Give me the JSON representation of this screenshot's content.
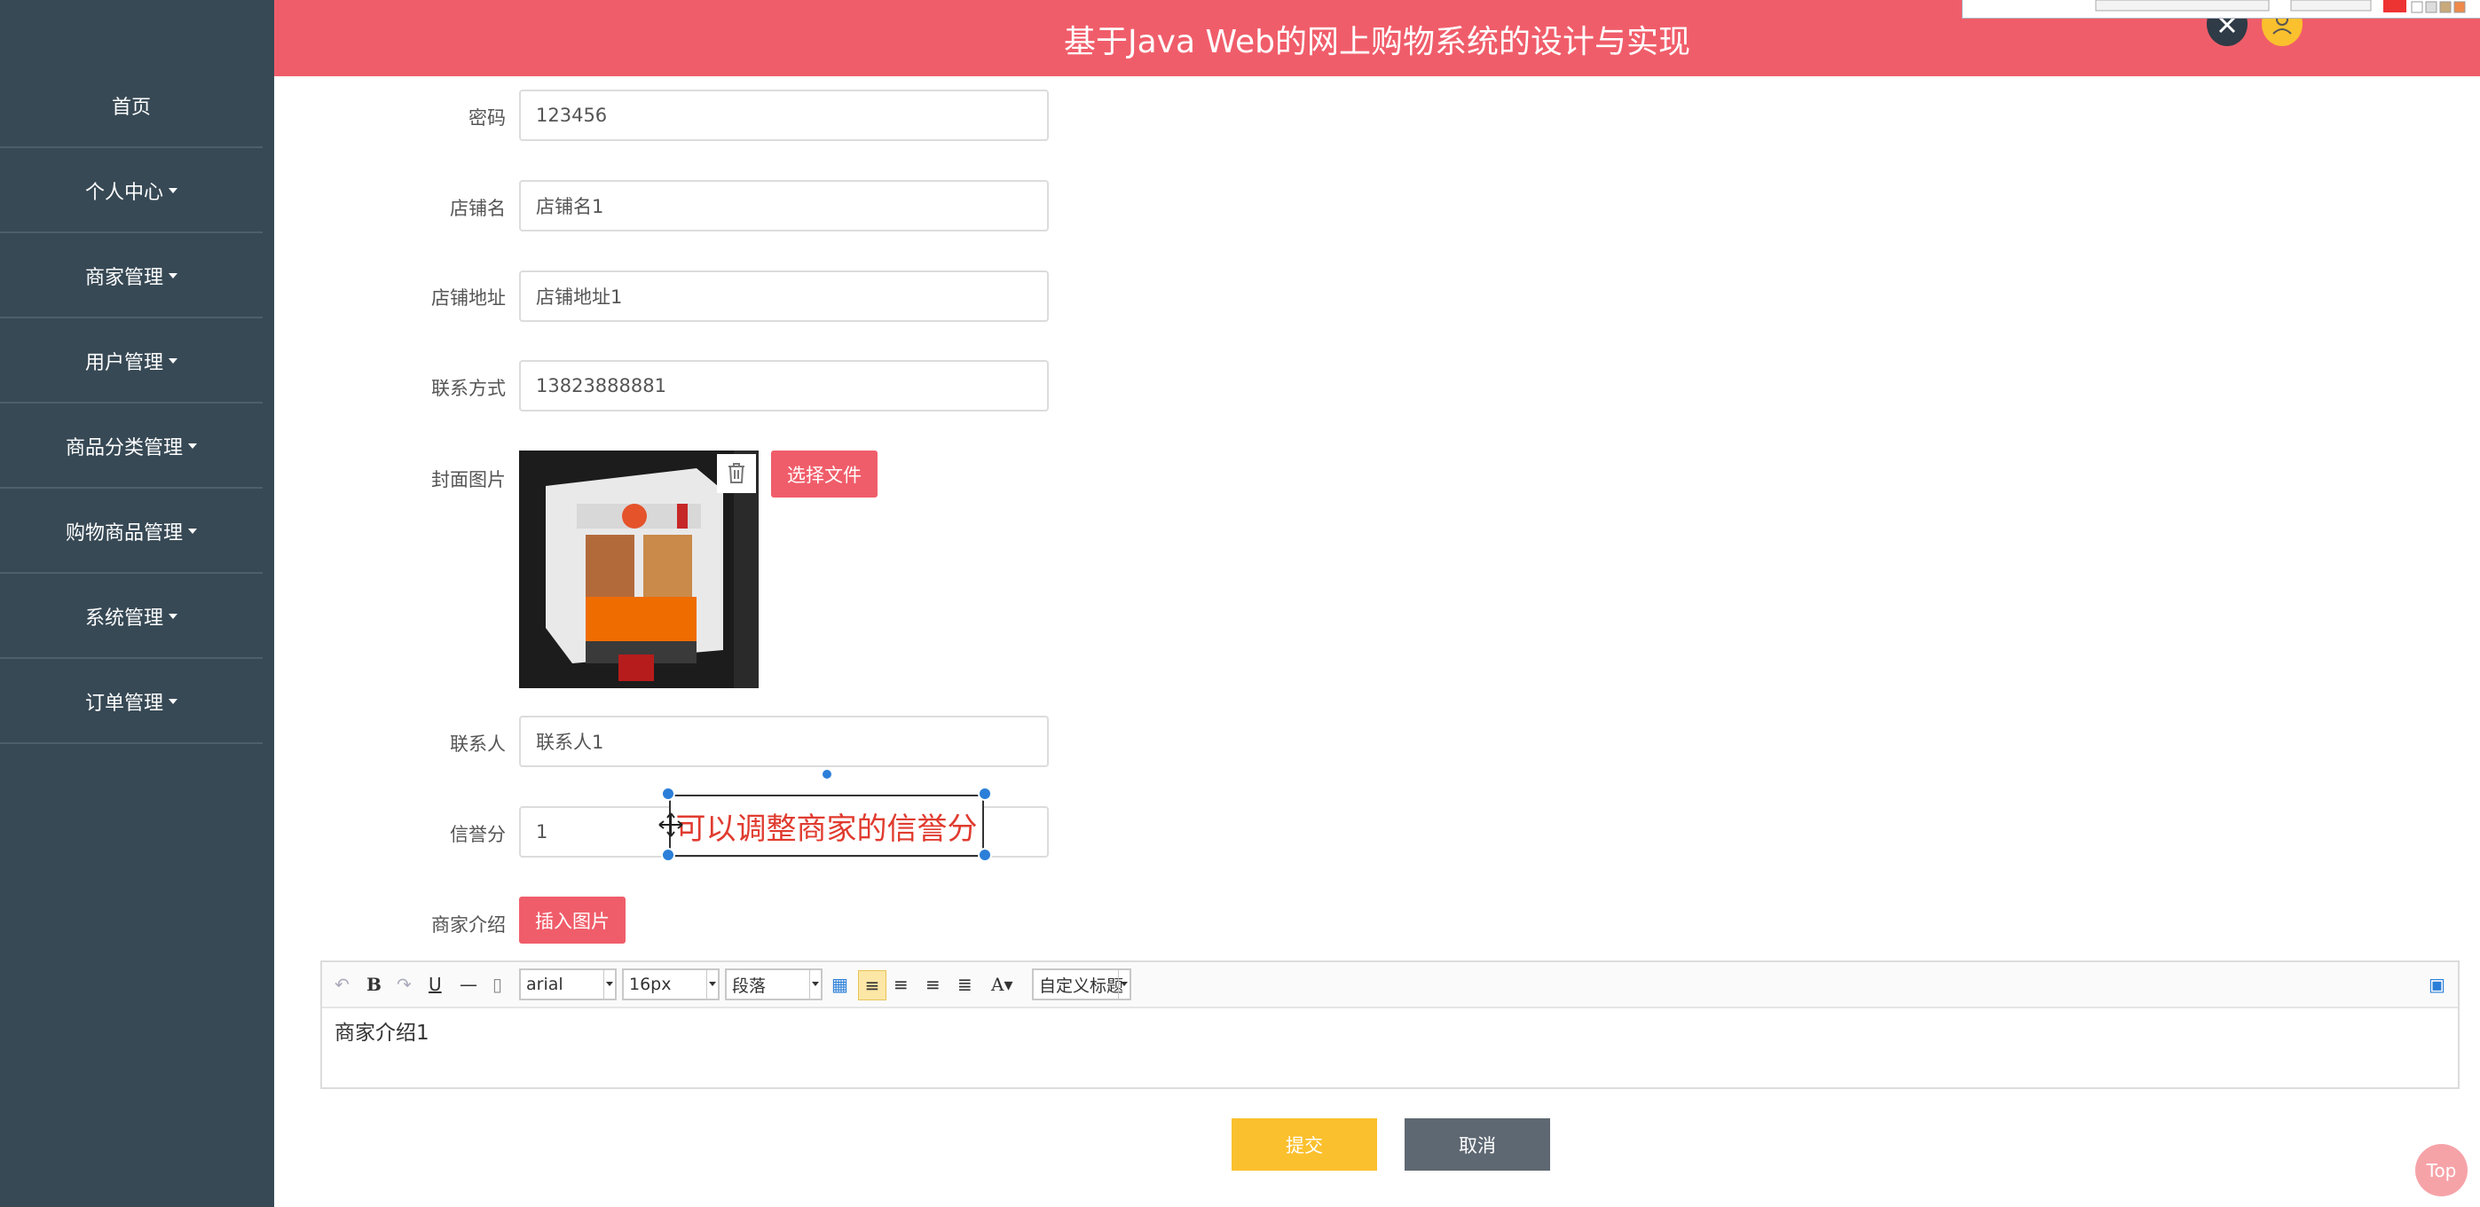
{
  "header": {
    "title": "基于Java Web的网上购物系统的设计与实现"
  },
  "sidebar": {
    "items": [
      {
        "label": "首页",
        "dropdown": false
      },
      {
        "label": "个人中心",
        "dropdown": true
      },
      {
        "label": "商家管理",
        "dropdown": true
      },
      {
        "label": "用户管理",
        "dropdown": true
      },
      {
        "label": "商品分类管理",
        "dropdown": true
      },
      {
        "label": "购物商品管理",
        "dropdown": true
      },
      {
        "label": "系统管理",
        "dropdown": true
      },
      {
        "label": "订单管理",
        "dropdown": true
      }
    ]
  },
  "form": {
    "password": {
      "label": "密码",
      "value": "123456"
    },
    "shop_name": {
      "label": "店铺名",
      "value": "店铺名1"
    },
    "shop_address": {
      "label": "店铺地址",
      "value": "店铺地址1"
    },
    "contact_phone": {
      "label": "联系方式",
      "value": "13823888881"
    },
    "cover_image": {
      "label": "封面图片",
      "choose_file_label": "选择文件"
    },
    "contact_person": {
      "label": "联系人",
      "value": "联系人1"
    },
    "credit_score": {
      "label": "信誉分",
      "value": "1"
    },
    "intro": {
      "label": "商家介绍",
      "insert_image_label": "插入图片"
    }
  },
  "editor": {
    "font_family": "arial",
    "font_size": "16px",
    "paragraph": "段落",
    "custom_heading": "自定义标题",
    "content": "商家介绍1"
  },
  "actions": {
    "submit_label": "提交",
    "cancel_label": "取消",
    "top_label": "Top"
  },
  "annotation": {
    "text": "可以调整商家的信誉分",
    "color": "#e03b2f"
  },
  "colors": {
    "header": "#f05d6a",
    "sidebar": "#374955",
    "submit": "#fbc02d",
    "cancel": "#5e6872"
  }
}
